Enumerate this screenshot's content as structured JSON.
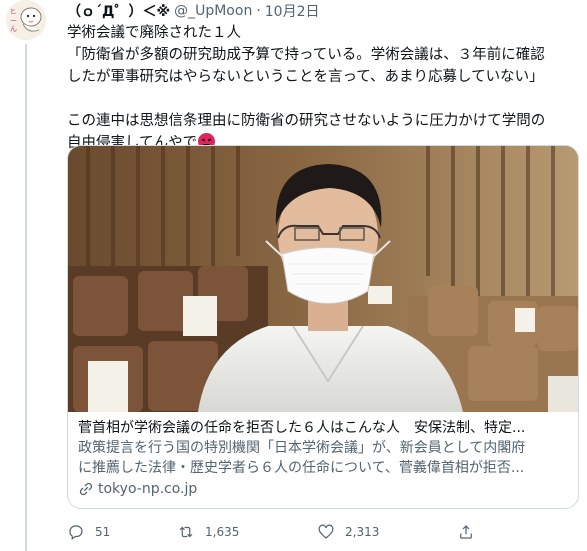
{
  "tweet": {
    "display_name": "（ｏ´Д゜）＜※",
    "handle": "@_UpMoon",
    "separator": "·",
    "date": "10月2日",
    "lines": [
      "学術会議で廃除された１人",
      "「防衛省が多額の研究助成予算で持っている。学術会議は、３年前に確認",
      "したが軍事研究はやらないということを言って、あまり応募していない」"
    ],
    "lines2": [
      "この連中は思想信条理由に防衛省の研究させないように圧力かけて学問の",
      "自由侵害してんやで"
    ],
    "emoji_name": "angry-face-emoji"
  },
  "card": {
    "title": "菅首相が学術会議の任命を拒否した６人はこんな人　安保法制、特定...",
    "description_lines": [
      "政策提言を行う国の特別機関「日本学術会議」が、新会員として内閣府",
      "に推薦した法律・歴史学者ら６人の任命について、菅義偉首相が拒否..."
    ],
    "domain": "tokyo-np.co.jp",
    "domain_icon": "link-icon",
    "image_desc_icon": "photo"
  },
  "actions": {
    "reply_count": "51",
    "retweet_count": "1,635",
    "like_count": "2,313",
    "reply_icon": "reply-icon",
    "retweet_icon": "retweet-icon",
    "like_icon": "heart-icon",
    "share_icon": "share-icon"
  },
  "avatar": {
    "label": "とーんと"
  },
  "colors": {
    "text": "#0f1419",
    "secondary": "#536471",
    "border": "#cfd9de",
    "emoji": "#e0245e"
  }
}
